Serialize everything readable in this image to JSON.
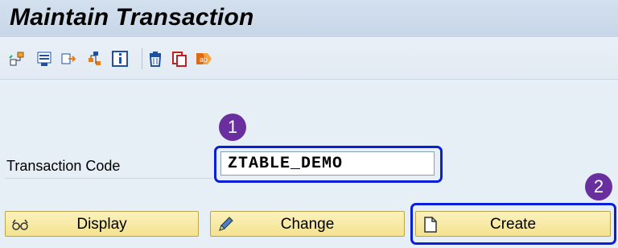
{
  "window": {
    "title": "Maintain Transaction"
  },
  "toolbar": {
    "icons": [
      "hierarchy-icon",
      "display-object-list-icon",
      "where-used-icon",
      "object-tree-icon",
      "info-icon",
      "delete-icon",
      "copy-icon",
      "rename-icon"
    ]
  },
  "form": {
    "transaction_label": "Transaction Code",
    "transaction_value": "ZTABLE_DEMO"
  },
  "annotations": {
    "step1": "1",
    "step2": "2"
  },
  "buttons": {
    "display": "Display",
    "change": "Change",
    "create": "Create"
  },
  "colors": {
    "highlight": "#0a1fd8",
    "badge": "#6a2f9e",
    "button": "#f4e28f"
  }
}
